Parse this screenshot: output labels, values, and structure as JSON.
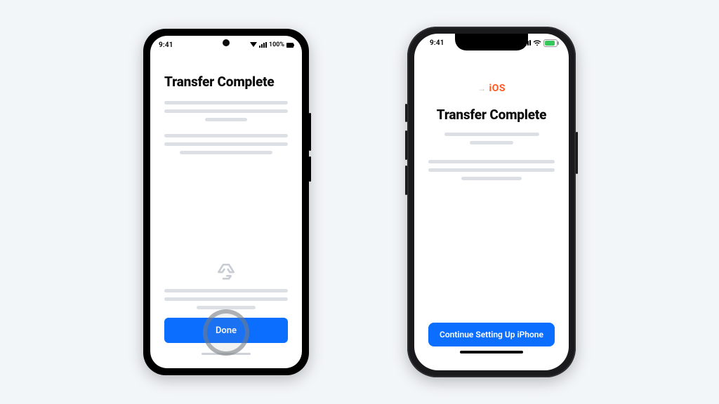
{
  "android": {
    "status": {
      "time": "9:41",
      "battery_text": "100%"
    },
    "title": "Transfer Complete",
    "recycle_icon": "recycle-icon",
    "button_label": "Done"
  },
  "iphone": {
    "status": {
      "time": "9:41"
    },
    "logo_text": "iOS",
    "title": "Transfer Complete",
    "button_label": "Continue Setting Up iPhone"
  },
  "colors": {
    "primary": "#0b6eff",
    "ios_orange": "#ff5a1f",
    "battery_green": "#34c759"
  }
}
